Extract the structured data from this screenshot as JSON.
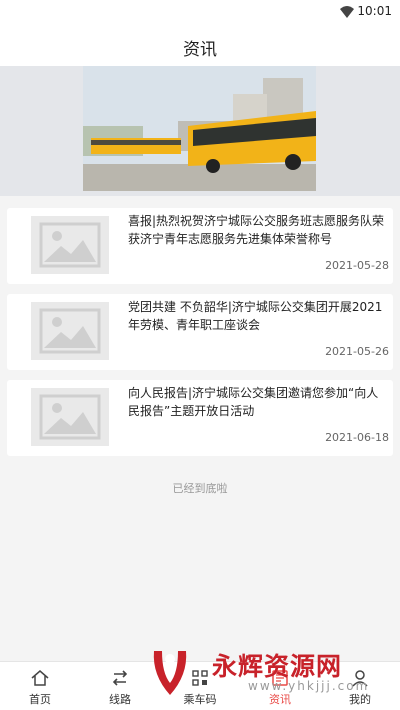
{
  "status_bar": {
    "time": "10:01"
  },
  "header": {
    "title": "资讯"
  },
  "news": [
    {
      "title": "喜报|热烈祝贺济宁城际公交服务班志愿服务队荣获济宁青年志愿服务先进集体荣誉称号",
      "date": "2021-05-28"
    },
    {
      "title": "党团共建 不负韶华|济宁城际公交集团开展2021年劳模、青年职工座谈会",
      "date": "2021-05-26"
    },
    {
      "title": "向人民报告|济宁城际公交集团邀请您参加“向人民报告”主题开放日活动",
      "date": "2021-06-18"
    }
  ],
  "footer_text": "已经到底啦",
  "tabs": [
    {
      "label": "首页",
      "icon": "home-icon"
    },
    {
      "label": "线路",
      "icon": "route-icon"
    },
    {
      "label": "乘车码",
      "icon": "qrcode-icon"
    },
    {
      "label": "资讯",
      "icon": "news-icon",
      "active": true
    },
    {
      "label": "我的",
      "icon": "user-icon"
    }
  ],
  "watermark": {
    "text": "永辉资源网",
    "url": "www.yhkjjj.com"
  },
  "colors": {
    "accent": "#e94a46",
    "bus_yellow": "#f2b318"
  }
}
